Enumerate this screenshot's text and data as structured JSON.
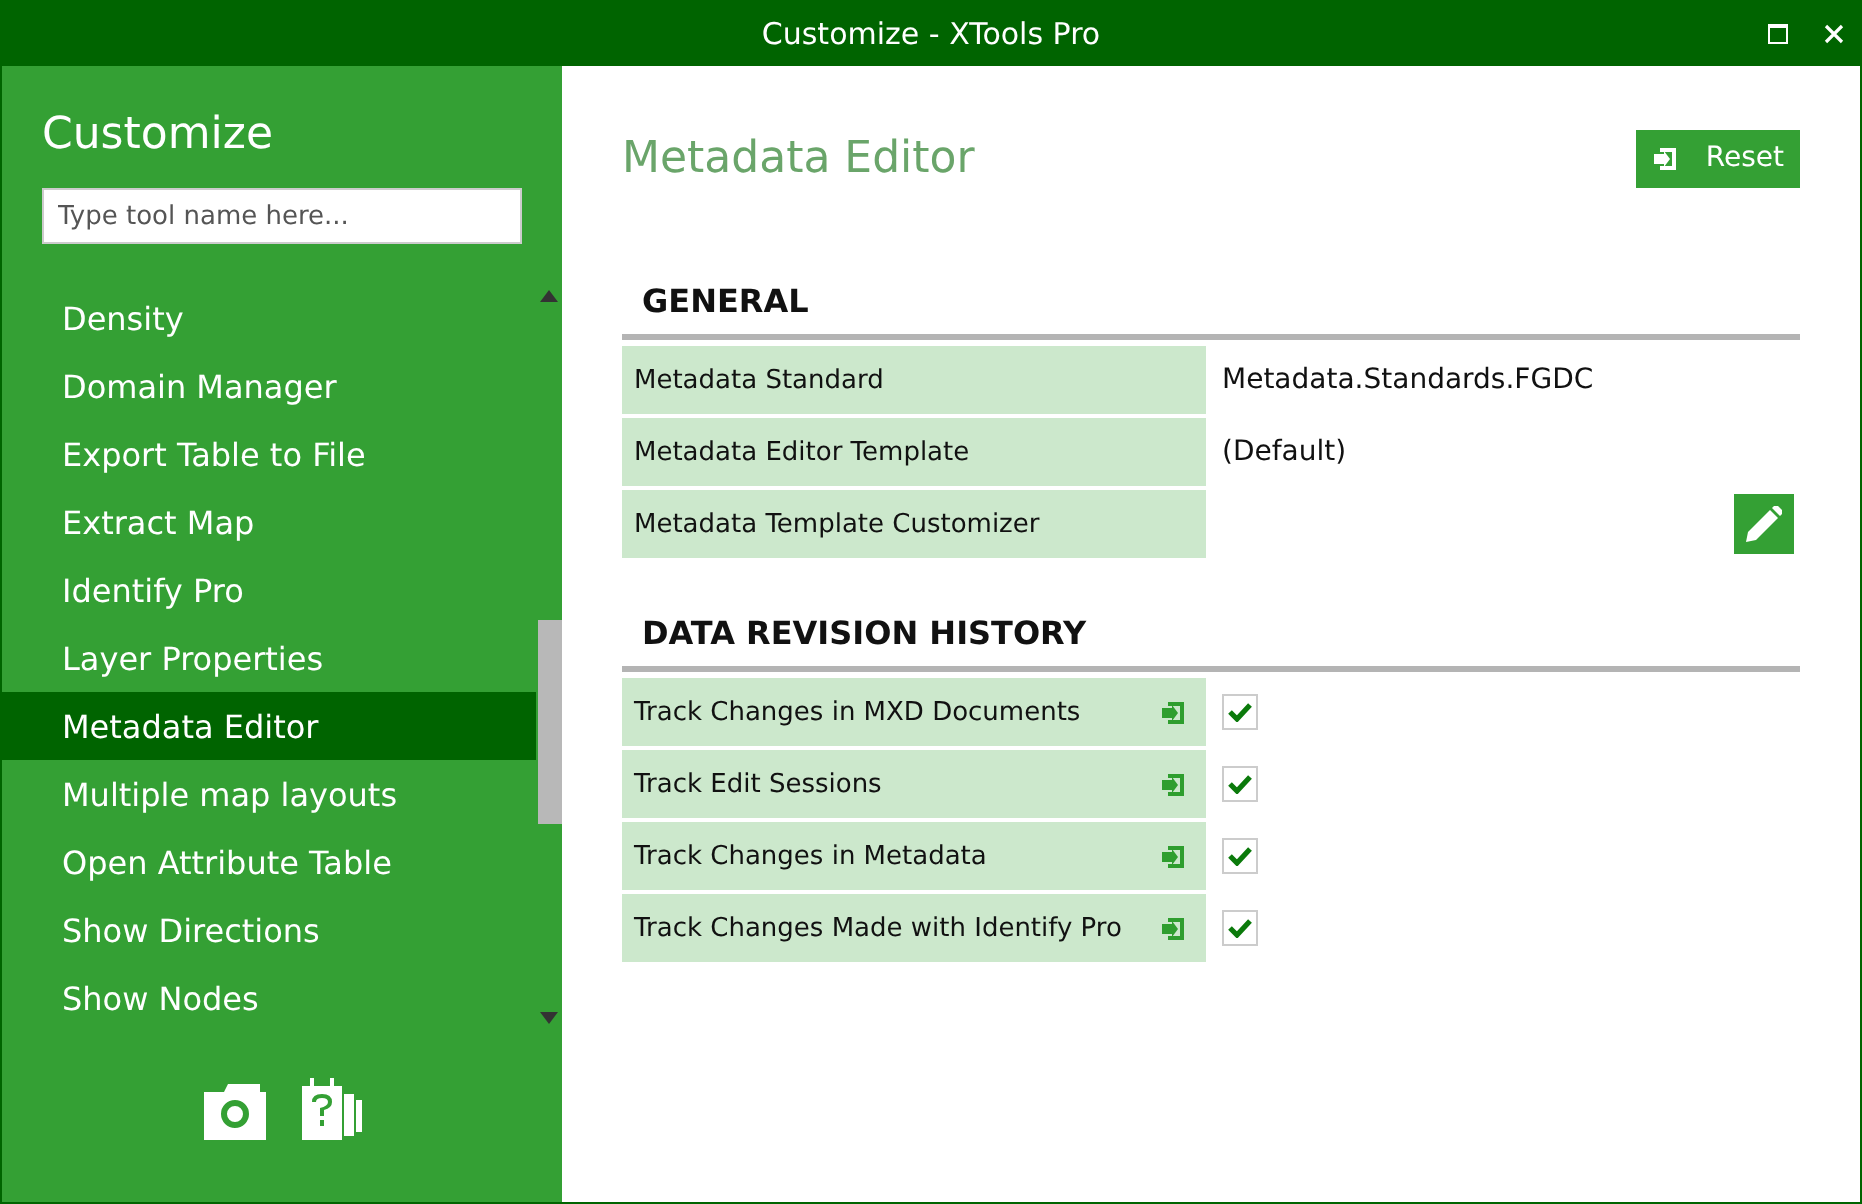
{
  "window": {
    "title": "Customize - XTools Pro"
  },
  "sidebar": {
    "title": "Customize",
    "search": {
      "placeholder": "Type tool name here..."
    },
    "items": [
      {
        "label": "Density",
        "selected": false
      },
      {
        "label": "Domain Manager",
        "selected": false
      },
      {
        "label": "Export Table to File",
        "selected": false
      },
      {
        "label": "Extract Map",
        "selected": false
      },
      {
        "label": "Identify Pro",
        "selected": false
      },
      {
        "label": "Layer Properties",
        "selected": false
      },
      {
        "label": "Metadata Editor",
        "selected": true
      },
      {
        "label": "Multiple map layouts",
        "selected": false
      },
      {
        "label": "Open Attribute Table",
        "selected": false
      },
      {
        "label": "Show Directions",
        "selected": false
      },
      {
        "label": "Show Nodes",
        "selected": false
      }
    ]
  },
  "main": {
    "title": "Metadata Editor",
    "reset_button": "Reset",
    "sections": [
      {
        "heading": "GENERAL",
        "rows": [
          {
            "kind": "text",
            "label": "Metadata Standard",
            "value": "Metadata.Standards.FGDC"
          },
          {
            "kind": "text",
            "label": "Metadata Editor Template",
            "value": "(Default)"
          },
          {
            "kind": "edit",
            "label": "Metadata Template Customizer"
          }
        ]
      },
      {
        "heading": "DATA REVISION HISTORY",
        "rows": [
          {
            "kind": "check",
            "label": "Track Changes in MXD Documents",
            "checked": true
          },
          {
            "kind": "check",
            "label": "Track Edit Sessions",
            "checked": true
          },
          {
            "kind": "check",
            "label": "Track Changes in Metadata",
            "checked": true
          },
          {
            "kind": "check",
            "label": "Track Changes Made with Identify Pro",
            "checked": true
          }
        ]
      }
    ]
  }
}
